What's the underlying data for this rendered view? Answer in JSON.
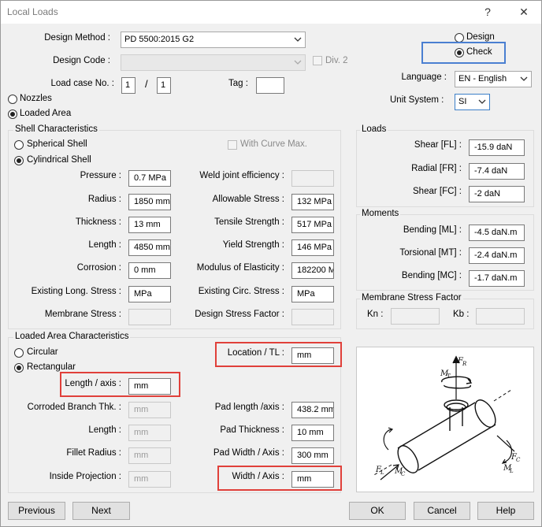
{
  "window": {
    "title": "Local Loads",
    "help_glyph": "?",
    "close_glyph": "✕"
  },
  "header": {
    "design_method_label": "Design Method :",
    "design_method_value": "PD 5500:2015 G2",
    "design_code_label": "Design Code :",
    "design_code_value": "",
    "div2_label": "Div. 2",
    "load_case_label": "Load case No. :",
    "load_case_value": "1",
    "load_case_sep": "/",
    "load_case_total": "1",
    "tag_label": "Tag :",
    "tag_value": "",
    "mode_design": "Design",
    "mode_check": "Check",
    "language_label": "Language :",
    "language_value": "EN - English",
    "unit_system_label": "Unit System :",
    "unit_system_value": "SI",
    "nozzles": "Nozzles",
    "loaded_area": "Loaded Area"
  },
  "shell": {
    "legend": "Shell Characteristics",
    "spherical": "Spherical Shell",
    "cylindrical": "Cylindrical Shell",
    "curve_max": "With Curve Max.",
    "pressure_label": "Pressure :",
    "pressure_value": "0.7 MPa",
    "radius_label": "Radius :",
    "radius_value": "1850 mm",
    "thickness_label": "Thickness :",
    "thickness_value": "13 mm",
    "length_label": "Length :",
    "length_value": "4850 mm",
    "corrosion_label": "Corrosion :",
    "corrosion_value": "0 mm",
    "exlong_label": "Existing Long. Stress :",
    "exlong_value": "MPa",
    "membrane_label": "Membrane Stress :",
    "membrane_value": "",
    "weld_label": "Weld joint efficiency :",
    "weld_value": "",
    "allow_label": "Allowable Stress :",
    "allow_value": "132 MPa",
    "tensile_label": "Tensile Strength :",
    "tensile_value": "517 MPa",
    "yield_label": "Yield Strength :",
    "yield_value": "146 MPa",
    "modulus_label": "Modulus of Elasticity :",
    "modulus_value": "182200 M",
    "excirc_label": "Existing Circ. Stress :",
    "excirc_value": "MPa",
    "dsf_label": "Design Stress Factor :",
    "dsf_value": ""
  },
  "loads": {
    "legend": "Loads",
    "shear_fl_label": "Shear [FL] :",
    "shear_fl_value": "-15.9 daN",
    "radial_fr_label": "Radial [FR] :",
    "radial_fr_value": "-7.4 daN",
    "shear_fc_label": "Shear [FC] :",
    "shear_fc_value": "-2 daN"
  },
  "moments": {
    "legend": "Moments",
    "ml_label": "Bending [ML] :",
    "ml_value": "-4.5 daN.m",
    "mt_label": "Torsional [MT] :",
    "mt_value": "-2.4 daN.m",
    "mc_label": "Bending [MC] :",
    "mc_value": "-1.7 daN.m"
  },
  "membrane_factor": {
    "legend": "Membrane Stress Factor",
    "kn_label": "Kn :",
    "kb_label": "Kb :"
  },
  "loaded_area": {
    "legend": "Loaded Area Characteristics",
    "circular": "Circular",
    "rectangular": "Rectangular",
    "location_label": "Location / TL :",
    "location_value": "mm",
    "length_axis_label": "Length / axis :",
    "length_axis_value": "mm",
    "corroded_label": "Corroded Branch Thk. :",
    "corroded_value": "mm",
    "blength_label": "Length :",
    "blength_value": "mm",
    "fillet_label": "Fillet Radius :",
    "fillet_value": "mm",
    "inside_label": "Inside Projection :",
    "inside_value": "mm",
    "padlen_label": "Pad length /axis :",
    "padlen_value": "438.2 mm",
    "padthk_label": "Pad Thickness :",
    "padthk_value": "10 mm",
    "padwid_label": "Pad Width / Axis :",
    "padwid_value": "300 mm",
    "width_label": "Width / Axis :",
    "width_value": "mm"
  },
  "diagram": {
    "fr": "F",
    "fr_sub": "R",
    "mt": "M",
    "mt_sub": "T",
    "fc": "F",
    "fc_sub": "C",
    "mc": "M",
    "mc_sub": "C",
    "fl": "F",
    "fl_sub": "L",
    "ml": "M",
    "ml_sub": "L"
  },
  "buttons": {
    "previous": "Previous",
    "next": "Next",
    "ok": "OK",
    "cancel": "Cancel",
    "help": "Help"
  },
  "colors": {
    "highlight_red": "#e0403a",
    "highlight_blue": "#4a7fd1",
    "focus_border": "#3c7fc8"
  }
}
